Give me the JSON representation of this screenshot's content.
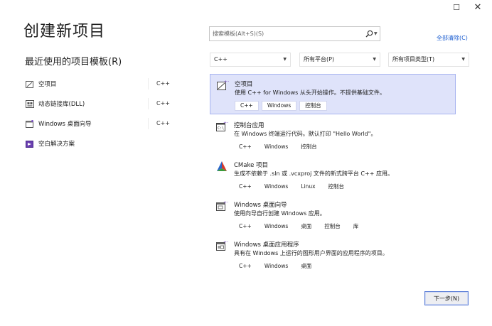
{
  "window": {
    "maximize_glyph": "☐",
    "close_glyph": "✕"
  },
  "page_title": "创建新项目",
  "recent": {
    "title": "最近使用的项目模板(R)",
    "items": [
      {
        "label": "空项目",
        "lang": "C++",
        "icon": "empty-project-icon"
      },
      {
        "label": "动态链接库(DLL)",
        "lang": "C++",
        "icon": "dll-icon"
      },
      {
        "label": "Windows 桌面向导",
        "lang": "C++",
        "icon": "desktop-wizard-icon"
      },
      {
        "label": "空白解决方案",
        "lang": "",
        "icon": "blank-solution-icon"
      }
    ]
  },
  "search": {
    "placeholder": "搜索模板(Alt+S)(S)",
    "clear_all": "全部清除(C)"
  },
  "filters": {
    "language": "C++",
    "platform": "所有平台(P)",
    "project_type": "所有项目类型(T)"
  },
  "templates": [
    {
      "title": "空项目",
      "desc": "使用 C++ for Windows 从头开始操作。不提供基础文件。",
      "tags": [
        "C++",
        "Windows",
        "控制台"
      ],
      "icon": "empty-project-icon",
      "selected": true
    },
    {
      "title": "控制台应用",
      "desc": "在 Windows 终端运行代码。默认打印 \"Hello World\"。",
      "tags": [
        "C++",
        "Windows",
        "控制台"
      ],
      "icon": "console-app-icon",
      "selected": false
    },
    {
      "title": "CMake 项目",
      "desc": "生成不依赖于 .sln 或 .vcxproj 文件的新式跨平台 C++ 应用。",
      "tags": [
        "C++",
        "Windows",
        "Linux",
        "控制台"
      ],
      "icon": "cmake-icon",
      "selected": false
    },
    {
      "title": "Windows 桌面向导",
      "desc": "使用向导自行创建 Windows 应用。",
      "tags": [
        "C++",
        "Windows",
        "桌面",
        "控制台",
        "库"
      ],
      "icon": "desktop-wizard-icon",
      "selected": false
    },
    {
      "title": "Windows 桌面应用程序",
      "desc": "具有在 Windows 上运行的图形用户界面的应用程序的项目。",
      "tags": [
        "C++",
        "Windows",
        "桌面"
      ],
      "icon": "desktop-app-icon",
      "selected": false
    }
  ],
  "next_button": "下一步(N)",
  "colors": {
    "accent": "#1a5cd0",
    "selected_bg": "#dfe3fa",
    "selected_border": "#a8b4f0",
    "cpp_star": "#7b4fbf",
    "cmake_red": "#d43a2f",
    "cmake_green": "#3a9b3a",
    "cmake_blue": "#2a66c8"
  }
}
